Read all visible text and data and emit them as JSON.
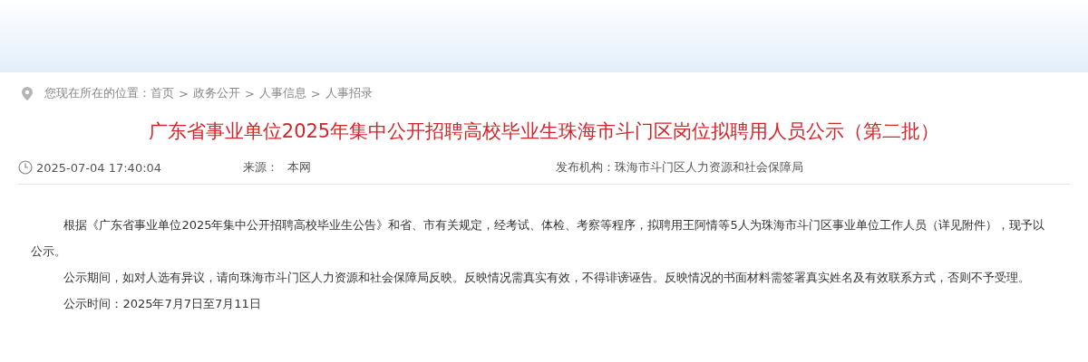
{
  "breadcrumb": {
    "prefix": "您现在所在的位置：",
    "separator": ">",
    "items": [
      "首页",
      "政务公开",
      "人事信息",
      "人事招录"
    ]
  },
  "article": {
    "title": "广东省事业单位2025年集中公开招聘高校毕业生珠海市斗门区岗位拟聘用人员公示（第二批）",
    "date": "2025-07-04 17:40:04",
    "source_label": "来源：",
    "source": "本网",
    "publisher_label": "发布机构：",
    "publisher": "珠海市斗门区人力资源和社会保障局",
    "paragraphs": [
      "根据《广东省事业单位2025年集中公开招聘高校毕业生公告》和省、市有关规定，经考试、体检、考察等程序，拟聘用王阿情等5人为珠海市斗门区事业单位工作人员（详见附件），现予以公示。",
      "公示期间，如对人选有异议，请向珠海市斗门区人力资源和社会保障局反映。反映情况需真实有效，不得诽谤诬告。反映情况的书面材料需签署真实姓名及有效联系方式，否则不予受理。",
      "公示时间：2025年7月7日至7月11日"
    ]
  }
}
